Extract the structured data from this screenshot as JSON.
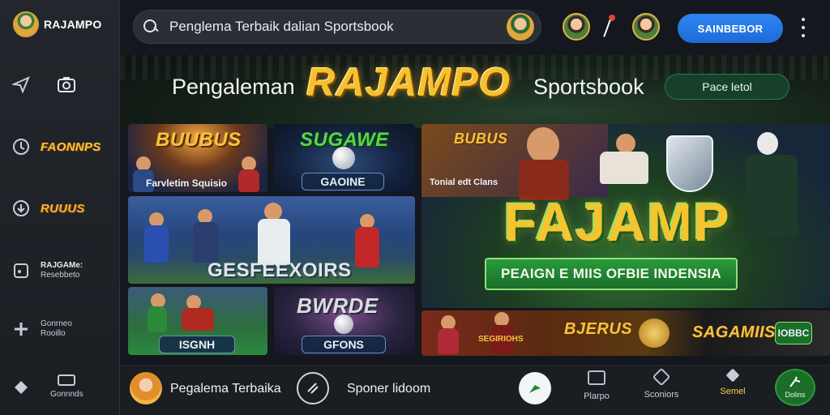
{
  "sidebar": {
    "brand": "RAJAMPO",
    "items": [
      {
        "logo": "FAONNPS"
      },
      {
        "logo": "RUUUS"
      },
      {
        "label_1": "RAJGAMe:",
        "label_2": "Resebbeto"
      },
      {
        "label_1": "Gonrneo",
        "label_2": "Rooillo"
      },
      {
        "label_1": "Gonnnds"
      }
    ],
    "icons": [
      "send-icon",
      "camera-icon",
      "target-icon",
      "location-icon",
      "document-icon",
      "plus-icon",
      "diamond-icon",
      "monitor-icon"
    ]
  },
  "header": {
    "search_text": "Penglema Terbaik dalian Sportsbook",
    "cta_label": "SAINBEBOR"
  },
  "hero": {
    "left": "Pengaleman",
    "brand": "RAJAMPO",
    "right": "Sportsbook",
    "pill": "Pace letol"
  },
  "tiles": {
    "t1": {
      "logo": "BUUBUS",
      "caption": "Farvletim Squisio"
    },
    "t2": {
      "logo": "SUGAWE",
      "badge": "GAOINE"
    },
    "t3": {
      "caption": "GESFEEXOIRS"
    },
    "t4": {
      "badge": "ISGNH"
    },
    "t5": {
      "logo": "BWRDE",
      "badge": "GFONS"
    },
    "t6": {
      "logo_small": "BUBUS",
      "caption_small": "Tonial edt Clans",
      "big_logo": "FAJAMP",
      "banner": "PEAIGN E MIIS OFBIE INDENSIA"
    },
    "t7": {
      "caption_1": "SEGIRIOHS",
      "logo_1": "BJERUS",
      "logo_2": "SAGAMIIS",
      "badge": "IOBBC"
    }
  },
  "bottom_nav": {
    "left_text": "Pegalema Terbaika",
    "mid_text": "Sponer lidoom",
    "items": [
      "Plarpo",
      "Sconiors",
      "Semel",
      "Dolins"
    ]
  },
  "colors": {
    "accent_blue": "#2e86f2",
    "gold": "#f7c02e",
    "green": "#2a9a3a",
    "sidebar": "#1b1e23"
  }
}
